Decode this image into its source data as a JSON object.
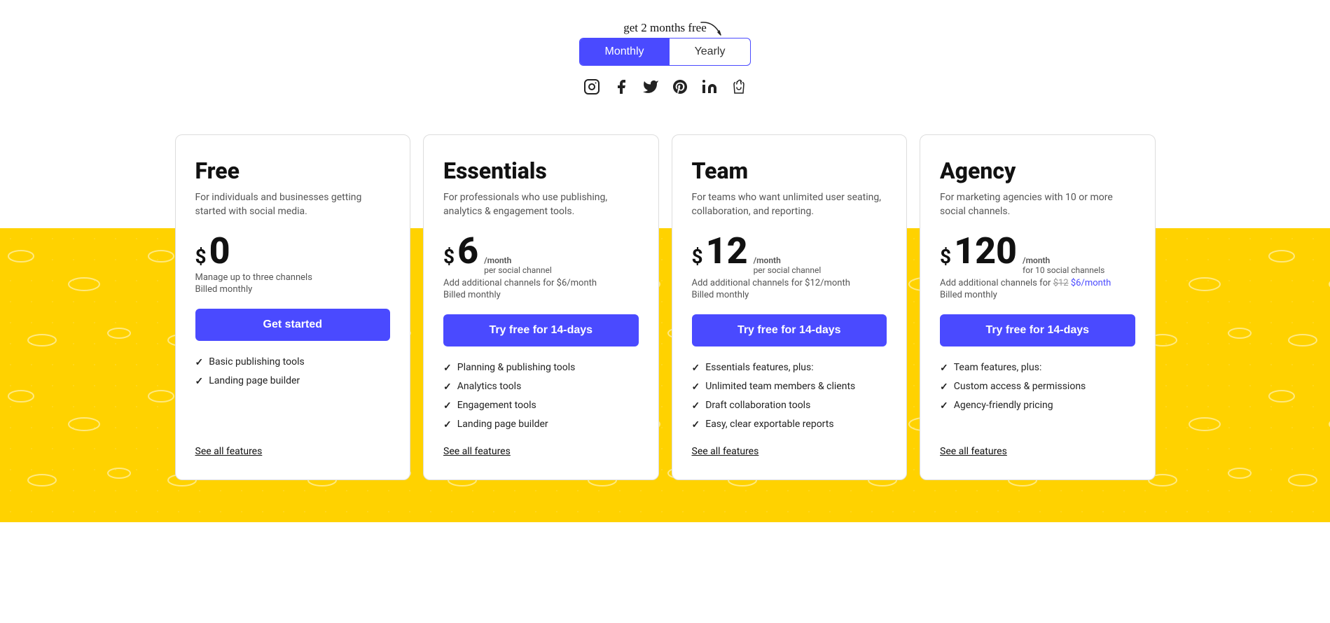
{
  "header": {
    "get2months": "get 2 months free",
    "toggle": {
      "monthly": "Monthly",
      "yearly": "Yearly"
    },
    "active_tab": "monthly",
    "social_icons": [
      "instagram",
      "facebook",
      "twitter",
      "pinterest",
      "linkedin",
      "shopify"
    ]
  },
  "plans": [
    {
      "id": "free",
      "name": "Free",
      "description": "For individuals and businesses getting started with social media.",
      "price_symbol": "$",
      "price": "0",
      "price_per": "",
      "price_channel": "",
      "additional_channels": "Manage up to three channels",
      "billed": "Billed monthly",
      "cta": "Get started",
      "features": [
        "Basic publishing tools",
        "Landing page builder"
      ],
      "see_all": "See all features"
    },
    {
      "id": "essentials",
      "name": "Essentials",
      "description": "For professionals who use publishing, analytics & engagement tools.",
      "price_symbol": "$",
      "price": "6",
      "price_per": "/month",
      "price_channel": "per social channel",
      "additional_channels": "Add additional channels for $6/month",
      "billed": "Billed monthly",
      "cta": "Try free for 14-days",
      "features": [
        "Planning & publishing tools",
        "Analytics tools",
        "Engagement tools",
        "Landing page builder"
      ],
      "see_all": "See all features"
    },
    {
      "id": "team",
      "name": "Team",
      "description": "For teams who want unlimited user seating, collaboration, and reporting.",
      "price_symbol": "$",
      "price": "12",
      "price_per": "/month",
      "price_channel": "per social channel",
      "additional_channels": "Add additional channels for $12/month",
      "billed": "Billed monthly",
      "cta": "Try free for 14-days",
      "features": [
        "Essentials features, plus:",
        "Unlimited team members & clients",
        "Draft collaboration tools",
        "Easy, clear exportable reports"
      ],
      "see_all": "See all features"
    },
    {
      "id": "agency",
      "name": "Agency",
      "description": "For marketing agencies with 10 or more social channels.",
      "price_symbol": "$",
      "price": "120",
      "price_per": "/month",
      "price_channel": "for 10 social channels",
      "additional_channels_prefix": "Add additional channels for ",
      "additional_channels_strike": "$12",
      "additional_channels_link": "$6/month",
      "billed": "Billed monthly",
      "cta": "Try free for 14-days",
      "features": [
        "Team features, plus:",
        "Custom access & permissions",
        "Agency-friendly pricing"
      ],
      "see_all": "See all features"
    }
  ]
}
